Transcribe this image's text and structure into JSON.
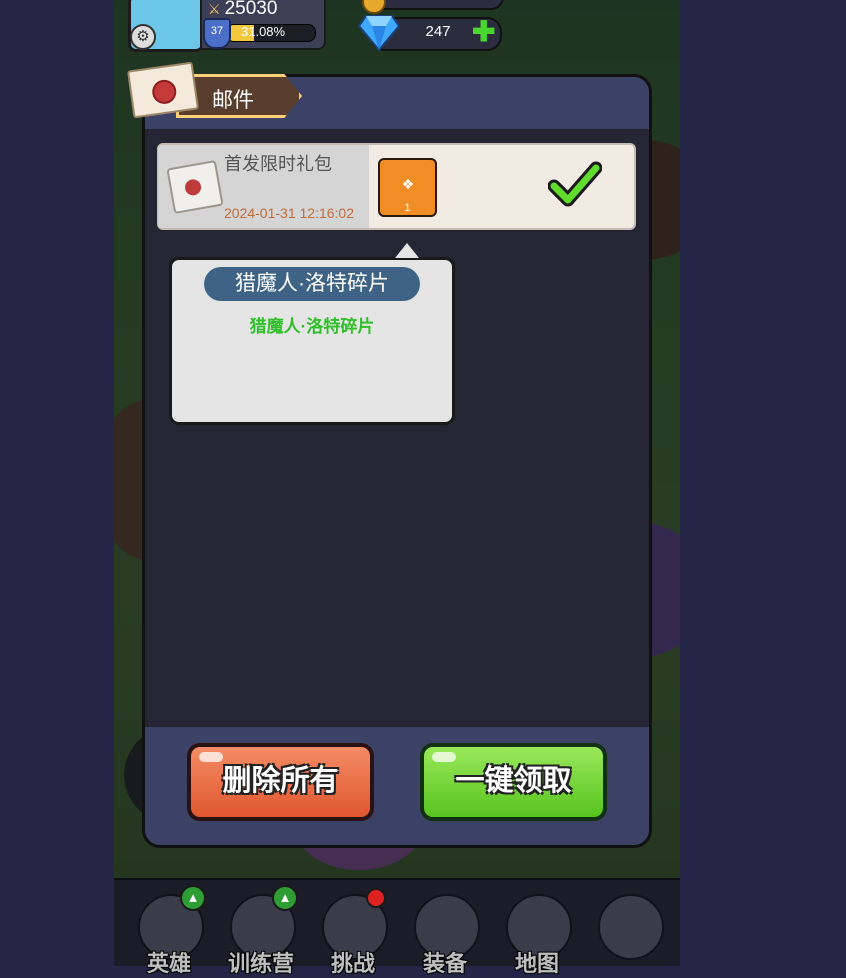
{
  "hud": {
    "power": "25030",
    "level": "37",
    "xp_percent": "31.08%",
    "xp_fraction": 0.31,
    "gems": "247"
  },
  "mail": {
    "title": "邮件",
    "item": {
      "subject": "首发限时礼包",
      "time": "2024-01-31 12:16:02",
      "reward_qty": "1",
      "claimed": true
    },
    "tooltip": {
      "name": "猎魔人·洛特碎片",
      "desc": "猎魔人·洛特碎片"
    },
    "buttons": {
      "delete_all": "删除所有",
      "claim_all": "一键领取"
    }
  },
  "nav": {
    "items": [
      {
        "label": "英雄",
        "icon": "hero-icon"
      },
      {
        "label": "训练营",
        "icon": "target-icon"
      },
      {
        "label": "挑战",
        "icon": "sword-icon"
      },
      {
        "label": "装备",
        "icon": "armor-icon"
      },
      {
        "label": "地图",
        "icon": "map-icon"
      },
      {
        "label": "",
        "icon": "lock-icon"
      }
    ]
  },
  "colors": {
    "delete_button": "#e0572f",
    "claim_button": "#58c41f",
    "tooltip_name_bg": "#3e6385",
    "tooltip_desc": "#2fbf2a"
  }
}
